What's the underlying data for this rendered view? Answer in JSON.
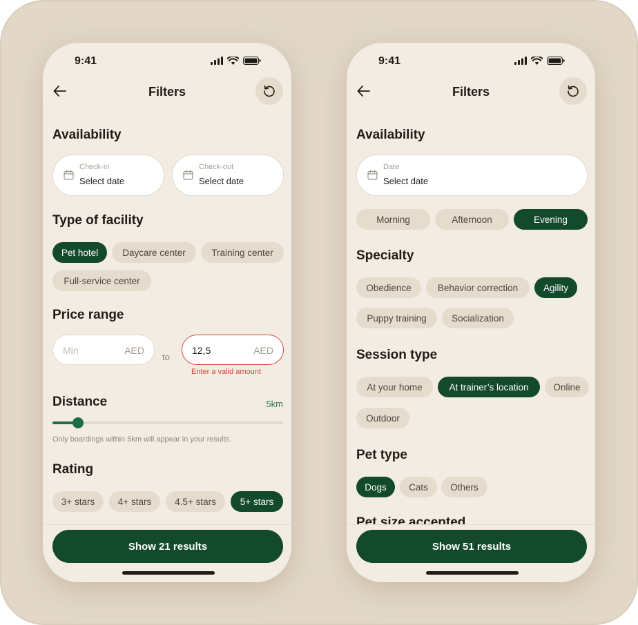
{
  "colors": {
    "accent": "#134a2c",
    "accent_soft": "#1f6b43",
    "chip_bg": "#e6dccd",
    "screen_bg": "#f3ece3",
    "error": "#d0473a"
  },
  "left": {
    "status": {
      "time": "9:41"
    },
    "nav": {
      "title": "Filters",
      "back_icon": "arrow-left-icon",
      "reset_icon": "reset-icon"
    },
    "availability": {
      "title": "Availability",
      "checkin": {
        "label": "Check-in",
        "value": "Select date"
      },
      "checkout": {
        "label": "Check-out",
        "value": "Select date"
      }
    },
    "facility": {
      "title": "Type of facility",
      "options": [
        "Pet hotel",
        "Daycare center",
        "Training center",
        "Full-service center"
      ],
      "selected": "Pet hotel"
    },
    "price": {
      "title": "Price range",
      "min_placeholder": "Min",
      "currency": "AED",
      "to": "to",
      "max_value": "12,5",
      "error": "Enter a valid amount"
    },
    "distance": {
      "title": "Distance",
      "value": "5km",
      "slider_fraction": 0.11,
      "note": "Only boardings within 5km will appear in your results."
    },
    "rating": {
      "title": "Rating",
      "options": [
        "3+ stars",
        "4+ stars",
        "4.5+ stars",
        "5+ stars"
      ],
      "selected": "5+ stars"
    },
    "cta": "Show 21 results"
  },
  "right": {
    "status": {
      "time": "9:41"
    },
    "nav": {
      "title": "Filters"
    },
    "availability": {
      "title": "Availability",
      "date": {
        "label": "Date",
        "value": "Select date"
      },
      "times": [
        "Morning",
        "Afternoon",
        "Evening"
      ],
      "selected_time": "Evening"
    },
    "specialty": {
      "title": "Specialty",
      "options": [
        "Obedience",
        "Behavior correction",
        "Agility",
        "Puppy training",
        "Socialization"
      ],
      "selected": "Agility"
    },
    "session": {
      "title": "Session type",
      "options": [
        "At your home",
        "At trainer’s location",
        "Online",
        "Outdoor"
      ],
      "selected": "At trainer’s location"
    },
    "pet": {
      "title": "Pet type",
      "options": [
        "Dogs",
        "Cats",
        "Others"
      ],
      "selected": "Dogs"
    },
    "pet_size_title": "Pet size accepted",
    "cta": "Show 51 results"
  }
}
